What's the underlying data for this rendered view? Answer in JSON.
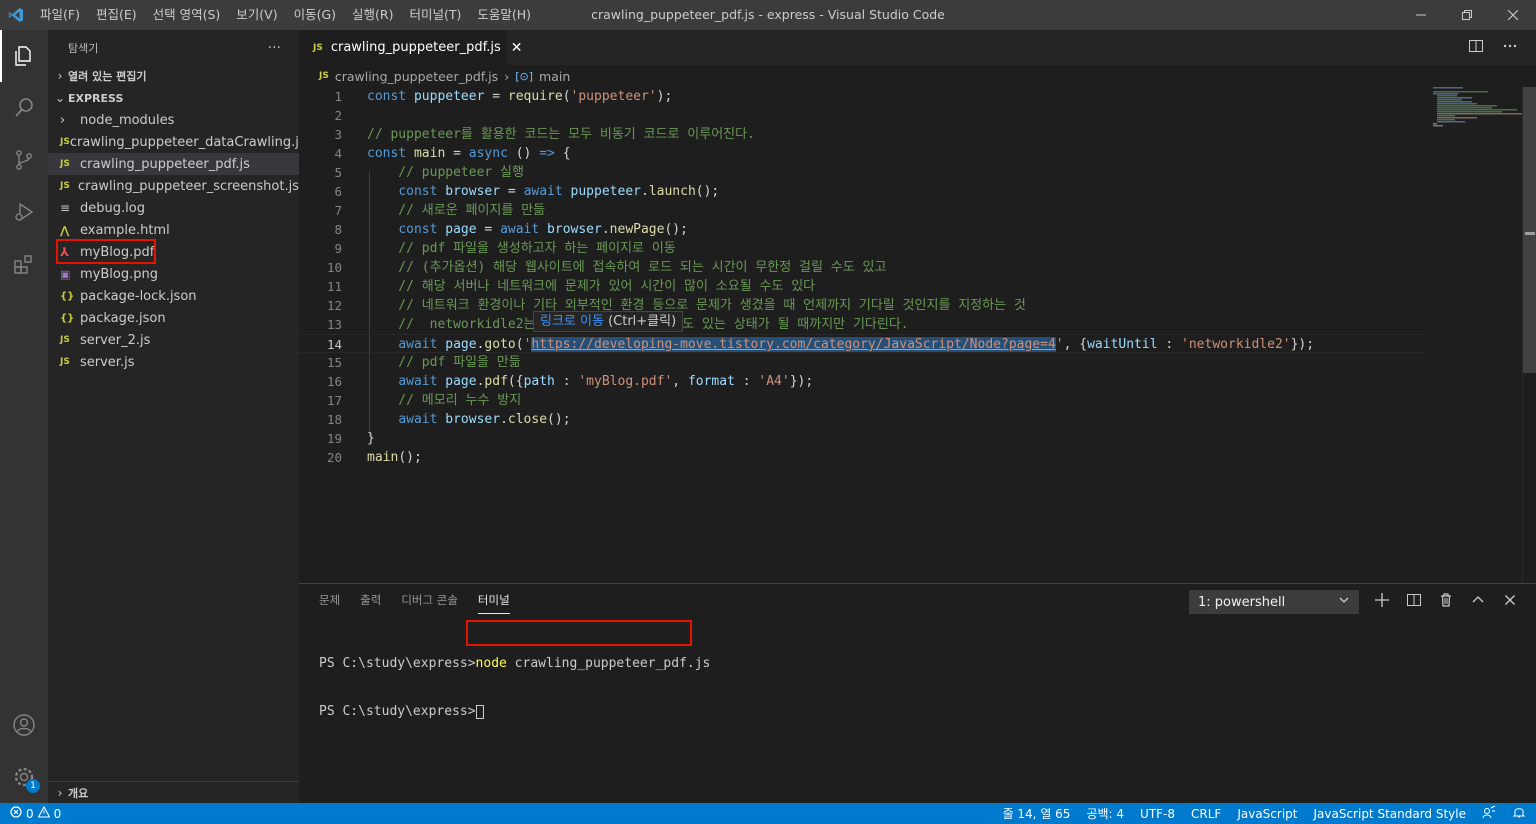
{
  "window": {
    "title": "crawling_puppeteer_pdf.js - express - Visual Studio Code",
    "menu": [
      "파일(F)",
      "편집(E)",
      "선택 영역(S)",
      "보기(V)",
      "이동(G)",
      "실행(R)",
      "터미널(T)",
      "도움말(H)"
    ]
  },
  "activity": {
    "badge": "1"
  },
  "sidebar": {
    "title": "탐색기",
    "more": "···",
    "open_editors": "열려 있는 편집기",
    "project": "EXPRESS",
    "outline": "개요",
    "items": [
      {
        "icon": "",
        "label": "node_modules",
        "type": "folder"
      },
      {
        "icon": "JS",
        "label": "crawling_puppeteer_dataCrawling.js",
        "type": "js"
      },
      {
        "icon": "JS",
        "label": "crawling_puppeteer_pdf.js",
        "type": "js"
      },
      {
        "icon": "JS",
        "label": "crawling_puppeteer_screenshot.js",
        "type": "js"
      },
      {
        "icon": "≡",
        "label": "debug.log",
        "type": "log"
      },
      {
        "icon": "⋀",
        "label": "example.html",
        "type": "html"
      },
      {
        "icon": "⅄",
        "label": "myBlog.pdf",
        "type": "pdf"
      },
      {
        "icon": "▣",
        "label": "myBlog.png",
        "type": "png"
      },
      {
        "icon": "{}",
        "label": "package-lock.json",
        "type": "json"
      },
      {
        "icon": "{}",
        "label": "package.json",
        "type": "json"
      },
      {
        "icon": "JS",
        "label": "server_2.js",
        "type": "js"
      },
      {
        "icon": "JS",
        "label": "server.js",
        "type": "js"
      }
    ]
  },
  "editor": {
    "tab": {
      "icon": "JS",
      "label": "crawling_puppeteer_pdf.js",
      "close": "✕"
    },
    "breadcrumb": {
      "file": "crawling_puppeteer_pdf.js",
      "symbol": "main"
    },
    "tooltip": {
      "link": "링크로 이동",
      "shortcut": "(Ctrl+클릭)"
    },
    "line_numbers": [
      "1",
      "2",
      "3",
      "4",
      "5",
      "6",
      "7",
      "8",
      "9",
      "10",
      "11",
      "12",
      "13",
      "14",
      "15",
      "16",
      "17",
      "18",
      "19",
      "20"
    ]
  },
  "panel": {
    "tabs": [
      "문제",
      "출력",
      "디버그 콘솔",
      "터미널"
    ],
    "active_tab": "터미널",
    "terminal_select": "1: powershell",
    "prompt1": "PS C:\\study\\express>",
    "command": "node crawling_puppeteer_pdf.js",
    "prompt2": "PS C:\\study\\express>"
  },
  "statusbar": {
    "errors": "0",
    "warnings": "0",
    "position": "줄 14, 열 65",
    "indent": "공백: 4",
    "encoding": "UTF-8",
    "eol": "CRLF",
    "language": "JavaScript",
    "formatter": "JavaScript Standard Style"
  },
  "colors": {
    "accent": "#007acc",
    "highlight_box": "#e51400"
  }
}
